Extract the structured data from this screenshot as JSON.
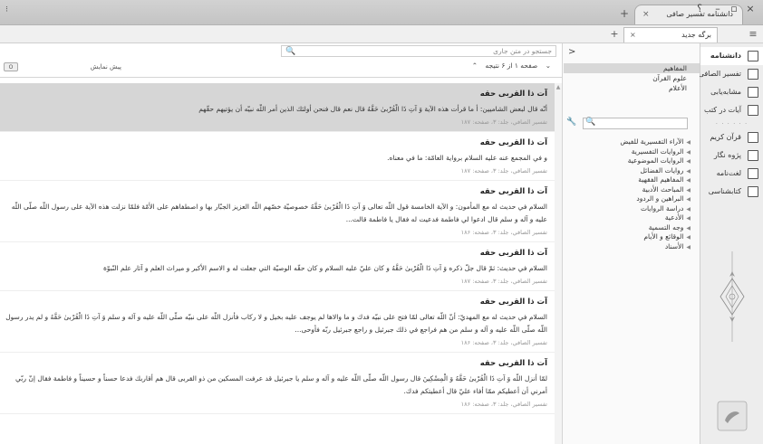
{
  "window": {
    "controls_left": "⁝",
    "btn_close": "×",
    "btn_max": "▫",
    "btn_min": "–",
    "btn_help": "؟"
  },
  "browser_tab": {
    "title": "دانشنامه تفسیر صافی",
    "close": "×",
    "new": "+"
  },
  "inner_tab": {
    "title": "برگه جدید",
    "close": "×",
    "new": "+"
  },
  "menu_icon": "≡",
  "sidebar": {
    "items": [
      {
        "label": "دانشنامه",
        "active": true,
        "icon": "encyclopedia-icon"
      },
      {
        "label": "تفسیر الصافی",
        "icon": "books-icon"
      },
      {
        "label": "مشابه‌یابی",
        "icon": "similar-icon"
      },
      {
        "label": "آیات در کتب",
        "icon": "verses-icon"
      }
    ],
    "items2": [
      {
        "label": "قرآن کریم",
        "icon": "quran-icon"
      },
      {
        "label": "پژوه نگار",
        "icon": "note-icon"
      },
      {
        "label": "لغت‌نامه",
        "icon": "dictionary-icon"
      },
      {
        "label": "کتابشناسی",
        "icon": "info-icon"
      }
    ]
  },
  "tree": {
    "back": "<",
    "topics": [
      "المفاهیم",
      "علوم القرآن",
      "الأعلام"
    ],
    "search_icon": "🔍",
    "wrench_icon": "🔧",
    "nodes": [
      "الآراء التفسیریة للفیض",
      "الروایات التفسیریة",
      "الروایات الموضوعیة",
      "روایات الفضائل",
      "المفاهیم الفقهیة",
      "المباحث الأدبیة",
      "البراهین و الردود",
      "دراسة الروایات",
      "الأدعیة",
      "وجه التسمیة",
      "الوقائع و الأیام",
      "الأسناد"
    ]
  },
  "main": {
    "search_placeholder": "جستجو در متن جاری",
    "results_label": "صفحه ۱ از ۶ نتیجه",
    "nav_prev": "⌄",
    "nav_next": "⌃",
    "preview_label": "پیش نمایش",
    "preview_toggle": "O",
    "results": [
      {
        "title": "آت ذا القربى حقه",
        "body": "أنّه قال لبعض الشاميين: أ ما قرأت هذه الآية وَ آتِ ذَا الْقُرْبىٰ حَقَّهُ قال نعم قال فنحن أولئك الذين أمر اللّه نبيّه أن يؤتيهم حقّهم",
        "ref": "تفسير الصافي، جلد: ۳، صفحه: ۱۸۷"
      },
      {
        "title": "آت ذا القربى حقه",
        "body": "و في المجمع عنه عليه السلام برواية العامّة: ما في معناه.",
        "ref": "تفسير الصافي، جلد: ۳، صفحه: ۱۸۷"
      },
      {
        "title": "آت ذا القربى حقه",
        "body": "السلام في حديث له مع المأمون: و الآية الخامسة قول اللّه تعالى وَ آتِ ذَا الْقُرْبىٰ حَقَّهُ خصوصيّة خصّهم اللّه العزيز الجبّار بها و اصطفاهم على الأمّة فلمّا نزلت هذه الآية على رسول اللّه صلّى اللّه عليه و آله و سلم قال ادعوا لي فاطمة فدعيت له فقال يا فاطمة قالت...",
        "ref": "تفسير الصافي، جلد: ۳، صفحه: ۱۸۶"
      },
      {
        "title": "آت ذا القربى حقه",
        "body": "السلام في حديث: ثمّ قال جلّ ذكره وَ آتِ ذَا الْقُرْبىٰ حَقَّهُ و كان عليّ عليه السلام و كان حقّه الوصيّة التي جعلت له و الاسم الأكبر و ميراث العلم و آثار علم النّبوّة",
        "ref": "تفسير الصافي، جلد: ۳، صفحه: ۱۸۷"
      },
      {
        "title": "آت ذا القربى حقه",
        "body": "السلام في حديث له مع المهديّ: أنّ اللّه تعالى لمّا فتح على نبيّه فدك و ما والاها لم يوجف عليه بخيل و لا ركاب فأنزل اللّه على نبيّه صلّى اللّه عليه و آله و سلم وَ آتِ ذَا الْقُرْبىٰ حَقَّهُ و لم يدر رسول اللّه صلّى اللّه عليه و آله و سلم من هم فراجع في ذلك جبرئيل و راجع جبرئيل ربّه فأوحى...",
        "ref": "تفسير الصافي، جلد: ۳، صفحه: ۱۸۶"
      },
      {
        "title": "آت ذا القربى حقه",
        "body": "لمّا أنزل اللّه وَ آتِ ذَا الْقُرْبىٰ حَقَّهُ وَ الْمِسْكِينَ قال رسول اللّه صلّى اللّه عليه و آله و سلم يا جبرئيل قد عرفت المسكين من ذو القربى قال هم أقاربك فدعا حسناً و حسيناً و فاطمة فقال إنّ ربّي أمرني أن أعطيكم ممّا أفاء عليّ قال أعطيتكم فدك.",
        "ref": "تفسير الصافي، جلد: ۳، صفحه: ۱۸۶"
      }
    ]
  }
}
